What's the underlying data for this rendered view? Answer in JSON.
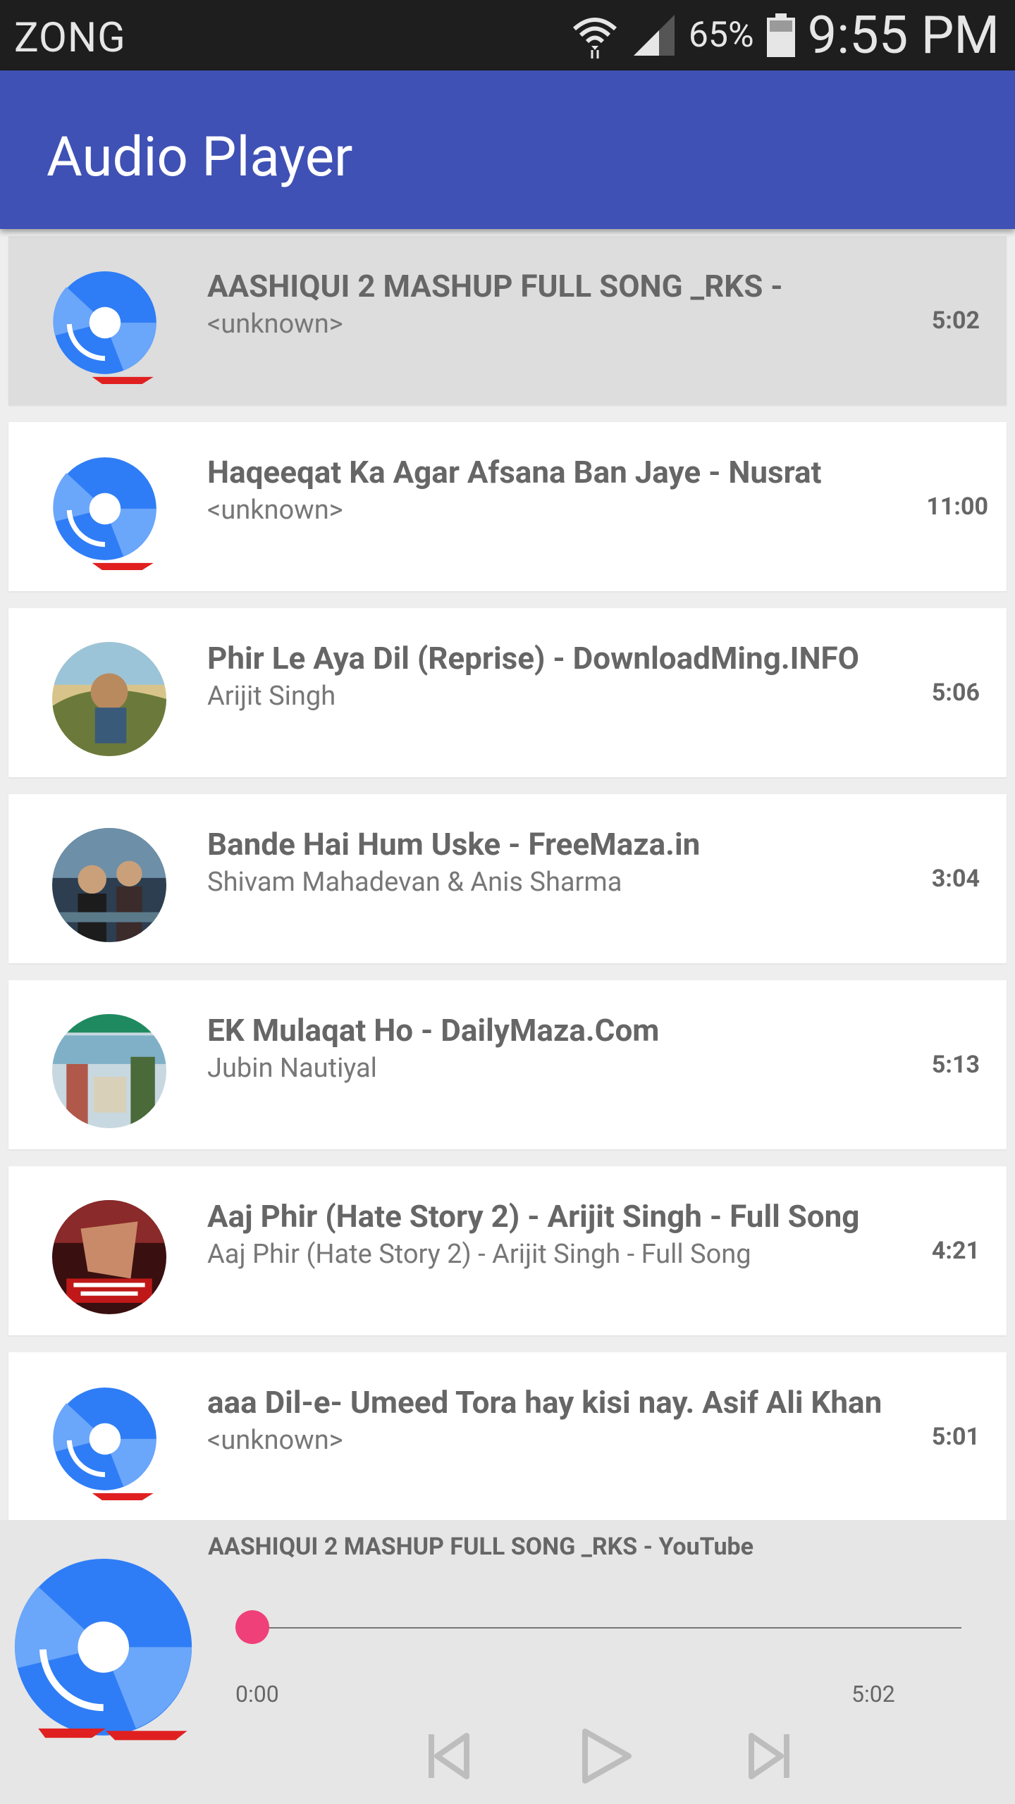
{
  "status_bar": {
    "carrier": "ZONG",
    "battery": "65%",
    "time": "9:55 PM"
  },
  "app_bar": {
    "title": "Audio Player"
  },
  "songs": [
    {
      "title": "AASHIQUI 2 MASHUP FULL SONG _RKS -",
      "artist": "<unknown>",
      "duration": "5:02",
      "art": "default-disc-icon",
      "selected": true
    },
    {
      "title": "Haqeeqat Ka Agar Afsana Ban Jaye - Nusrat",
      "artist": "<unknown>",
      "duration": "11:00",
      "art": "default-disc-icon"
    },
    {
      "title": "Phir Le Aya Dil (Reprise)  - DownloadMing.INFO",
      "artist": "Arijit Singh",
      "duration": "5:06",
      "art": "album-art"
    },
    {
      "title": "Bande Hai Hum Uske - FreeMaza.in",
      "artist": "Shivam Mahadevan & Anis Sharma",
      "duration": "3:04",
      "art": "album-art"
    },
    {
      "title": "EK Mulaqat Ho - DailyMaza.Com",
      "artist": "Jubin Nautiyal",
      "duration": "5:13",
      "art": "album-art"
    },
    {
      "title": "Aaj Phir (Hate Story 2) - Arijit Singh - Full  Song",
      "artist": "Aaj Phir (Hate Story 2) - Arijit Singh - Full  Song",
      "duration": "4:21",
      "art": "album-art"
    },
    {
      "title": "aaa Dil-e- Umeed Tora hay kisi nay. Asif Ali Khan",
      "artist": "<unknown>",
      "duration": "5:01",
      "art": "default-disc-icon"
    }
  ],
  "player": {
    "now_playing": "AASHIQUI 2 MASHUP FULL SONG _RKS - YouTube",
    "current_time": "0:00",
    "total_time": "5:02",
    "progress": 0,
    "controls": [
      "previous-icon",
      "play-icon",
      "next-icon"
    ]
  },
  "colors": {
    "app_bar": "#3f51b5",
    "accent": "#f0407a",
    "disc": "#2f7df6"
  }
}
